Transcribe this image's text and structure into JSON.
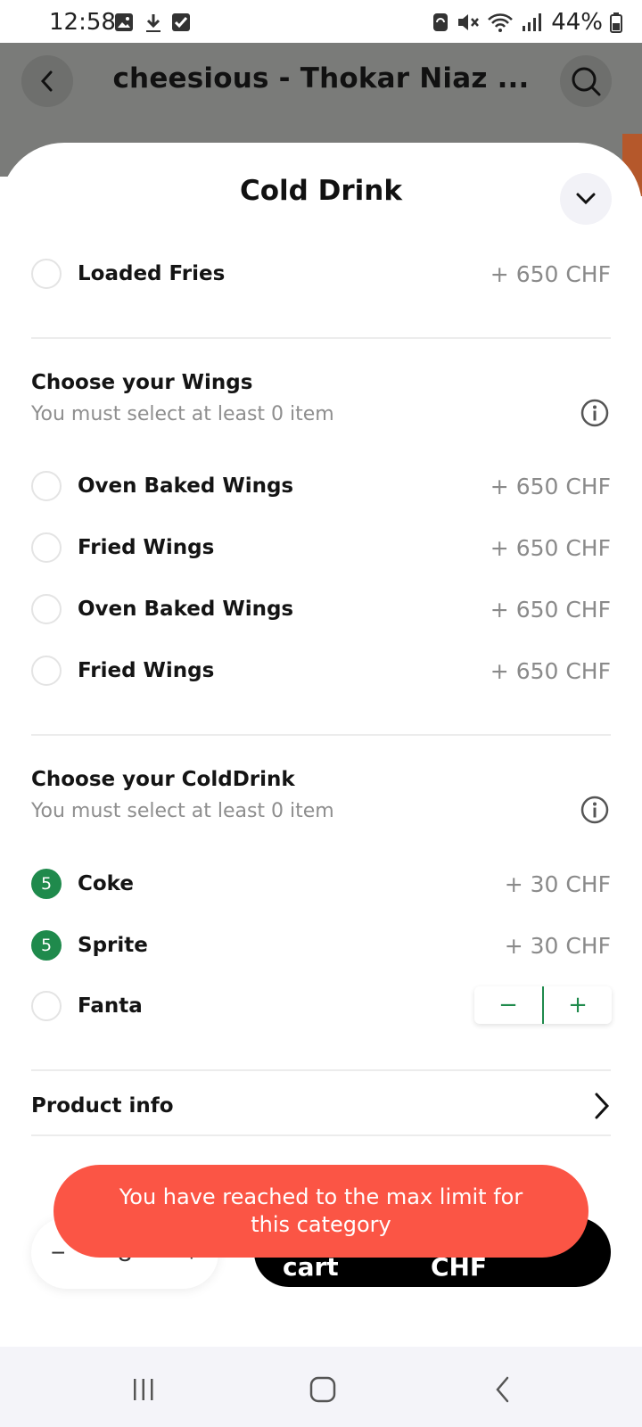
{
  "status_bar": {
    "time": "12:58",
    "battery_percent": "44%"
  },
  "header": {
    "title": "cheesious - Thokar Niaz ...",
    "back_icon": "chevron-left-icon",
    "search_icon": "search-icon"
  },
  "sheet": {
    "title": "Cold Drink",
    "collapse_icon": "chevron-down-icon",
    "top_item": {
      "label": "Loaded Fries",
      "price": "+ 650 CHF"
    },
    "wings": {
      "title": "Choose your Wings",
      "subtitle": "You must select at least 0 item",
      "items": [
        {
          "label": "Oven Baked Wings",
          "price": "+ 650 CHF"
        },
        {
          "label": "Fried Wings",
          "price": "+ 650 CHF"
        },
        {
          "label": "Oven Baked Wings",
          "price": "+ 650 CHF"
        },
        {
          "label": "Fried Wings",
          "price": "+ 650 CHF"
        }
      ]
    },
    "colddrink": {
      "title": "Choose your ColdDrink",
      "subtitle": "You must select at least 0 item",
      "items": [
        {
          "label": "Coke",
          "price": "+ 30 CHF",
          "count": "5"
        },
        {
          "label": "Sprite",
          "price": "+ 30 CHF",
          "count": "5"
        },
        {
          "label": "Fanta"
        }
      ],
      "stepper": {
        "minus": "−",
        "plus": "+"
      }
    },
    "product_info": "Product info"
  },
  "bottom": {
    "qty_minus": "−",
    "qty_value": "3",
    "qty_plus": "+",
    "add_to_cart": "Add to cart",
    "total": "540.00 CHF"
  },
  "toast": {
    "message": "You have reached to the max limit for this category"
  },
  "colors": {
    "accent_green": "#1f8a4c",
    "toast_red": "#fb5545",
    "dim_header": "#7a7b79"
  }
}
